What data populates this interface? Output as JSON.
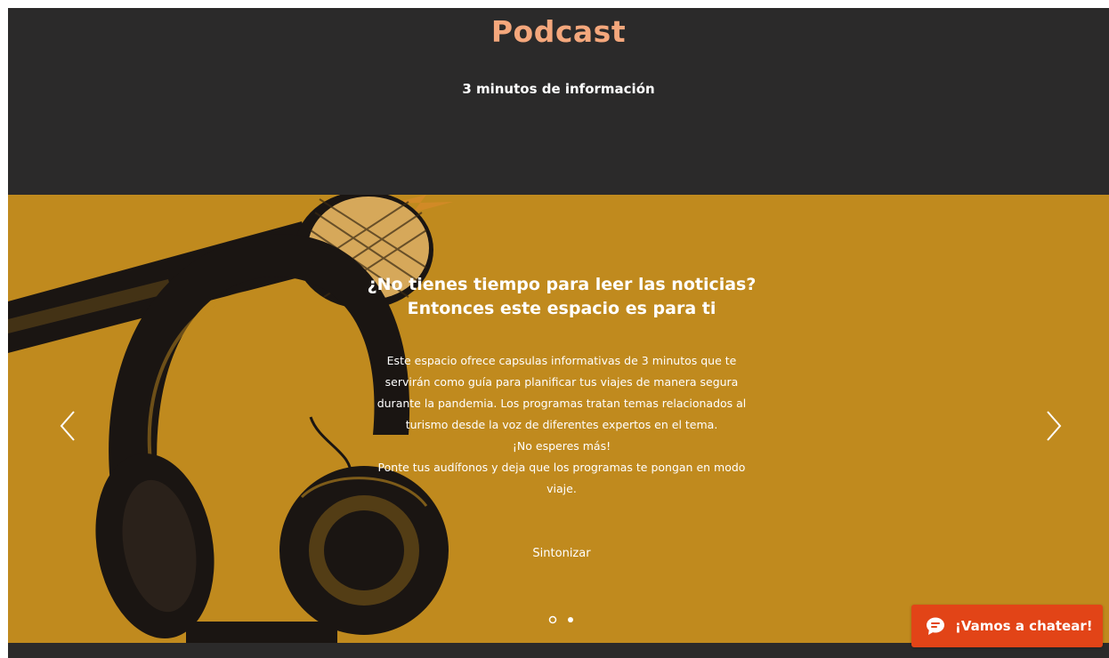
{
  "header": {
    "title": "Podcast",
    "subtitle": "3 minutos de información"
  },
  "slide": {
    "headline_line1": "¿No tienes tiempo para leer las noticias?",
    "headline_line2": "Entonces este espacio es para ti",
    "body_lines": [
      "Este espacio ofrece capsulas informativas de 3 minutos que te",
      "servirán como guía para planificar tus viajes de manera segura",
      "durante la pandemia. Los programas tratan temas relacionados al",
      "turismo desde la voz de diferentes expertos en el tema.",
      "¡No esperes más!",
      "Ponte tus audífonos y deja que los programas te pongan en modo",
      "viaje."
    ],
    "cta_label": "Sintonizar",
    "background_color": "#c08a1e",
    "image": "microphone-and-headphones-illustration"
  },
  "slider_nav": {
    "prev_icon": "chevron-left-icon",
    "next_icon": "chevron-right-icon",
    "dots": [
      {
        "index": 1,
        "active": true
      },
      {
        "index": 2,
        "active": false
      }
    ]
  },
  "chat_widget": {
    "label": "¡Vamos a chatear!",
    "icon": "chat-bubble-icon",
    "color": "#e24417"
  },
  "colors": {
    "dark_background": "#2b2a2a",
    "title_accent": "#f4a77c"
  }
}
